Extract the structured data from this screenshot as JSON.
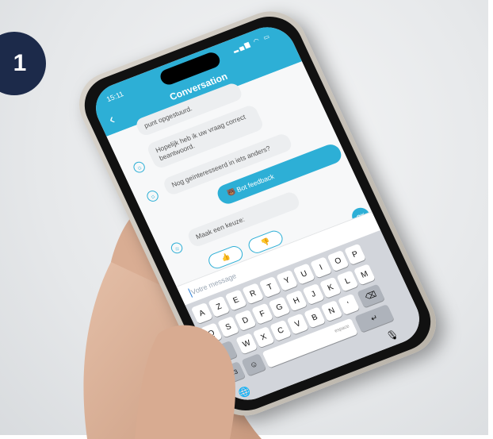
{
  "badge": {
    "number": "1"
  },
  "status": {
    "time": "15:11",
    "icons": "▂▄▆ ◠ ▭"
  },
  "header": {
    "title": "Conversation",
    "back_icon": "chevron-left-icon"
  },
  "messages": [
    {
      "from": "bot",
      "text": "punt opgestuurd."
    },
    {
      "from": "bot",
      "text": "Hopelijk heb ik uw vraag correct beantwoord."
    },
    {
      "from": "bot",
      "text": "Nog geïnteresseerd in iets anders?"
    },
    {
      "from": "user",
      "text": "🐻 Bot feedback"
    },
    {
      "from": "bot",
      "text": "Maak een keuze:"
    }
  ],
  "choices": [
    {
      "name": "thumbs-up",
      "glyph": "👍"
    },
    {
      "name": "thumbs-down",
      "glyph": "👎"
    }
  ],
  "ok_label": "OK",
  "input": {
    "placeholder": "Votre message"
  },
  "keyboard": {
    "row1": [
      "A",
      "Z",
      "E",
      "R",
      "T",
      "Y",
      "U",
      "I",
      "O",
      "P"
    ],
    "row2": [
      "Q",
      "S",
      "D",
      "F",
      "G",
      "H",
      "J",
      "K",
      "L",
      "M"
    ],
    "row3": [
      "W",
      "X",
      "C",
      "V",
      "B",
      "N",
      "'"
    ],
    "shift": "⬆",
    "backspace": "⌫",
    "numbers": "123",
    "emoji": "☺",
    "space_label": "espace",
    "return": "↵",
    "globe": "🌐",
    "mic": "🎙"
  },
  "colors": {
    "accent": "#2dafd6",
    "badge": "#1c2a4a",
    "keyboard_bg": "#d2d5db"
  }
}
